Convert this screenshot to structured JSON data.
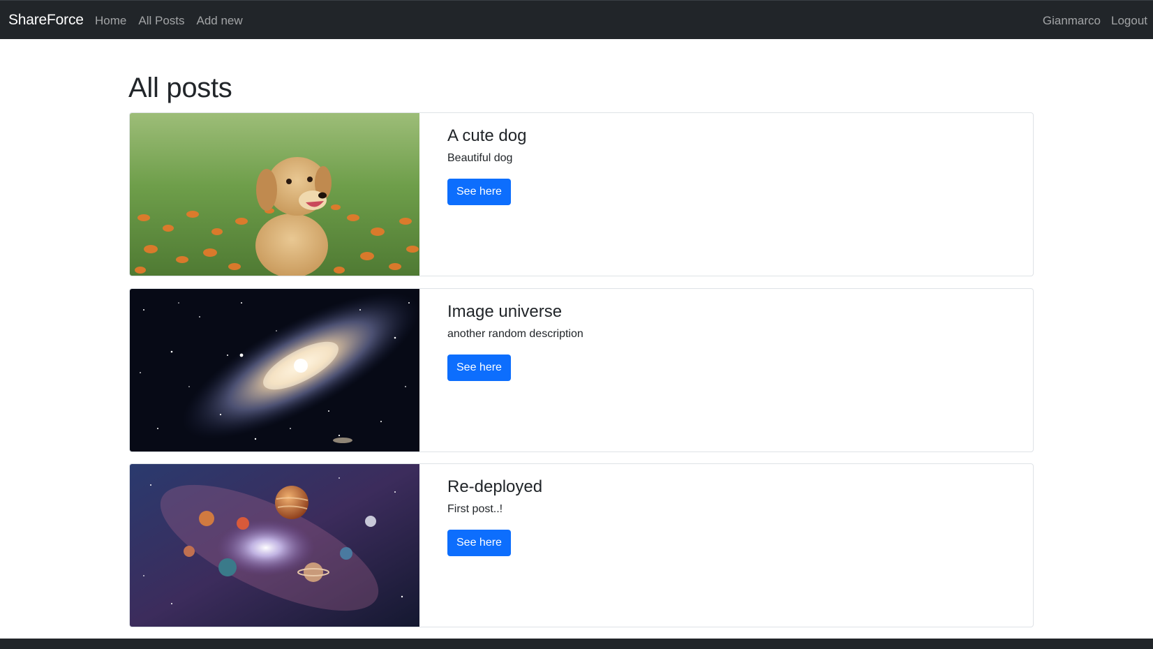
{
  "navbar": {
    "brand": "ShareForce",
    "links": [
      "Home",
      "All Posts",
      "Add new"
    ],
    "user": "Gianmarco",
    "logout": "Logout"
  },
  "page": {
    "title": "All posts"
  },
  "posts": [
    {
      "title": "A cute dog",
      "description": "Beautiful dog",
      "button": "See here",
      "image": "puppy in orange flower field"
    },
    {
      "title": "Image universe",
      "description": "another random description",
      "button": "See here",
      "image": "spiral galaxy"
    },
    {
      "title": "Re-deployed",
      "description": "First post..!",
      "button": "See here",
      "image": "planets in nebula"
    }
  ],
  "colors": {
    "navbar_bg": "#212529",
    "primary": "#0d6efd",
    "border": "#dee2e6"
  }
}
